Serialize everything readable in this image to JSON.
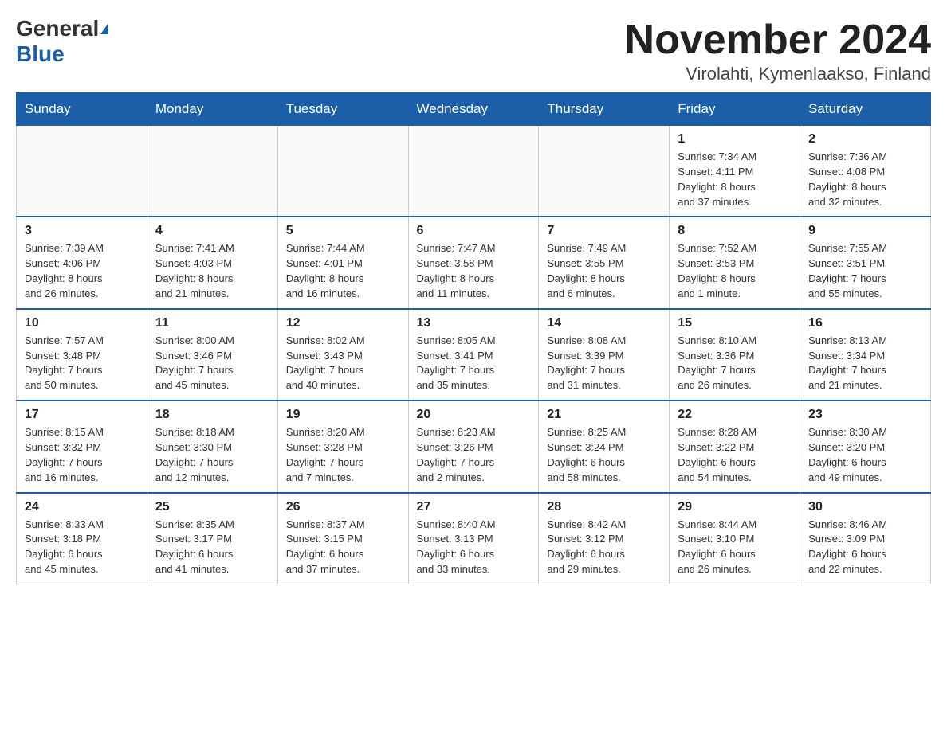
{
  "header": {
    "logo_general": "General",
    "logo_blue": "Blue",
    "month_title": "November 2024",
    "location": "Virolahti, Kymenlaakso, Finland"
  },
  "days_of_week": [
    "Sunday",
    "Monday",
    "Tuesday",
    "Wednesday",
    "Thursday",
    "Friday",
    "Saturday"
  ],
  "weeks": [
    [
      {
        "day": "",
        "info": ""
      },
      {
        "day": "",
        "info": ""
      },
      {
        "day": "",
        "info": ""
      },
      {
        "day": "",
        "info": ""
      },
      {
        "day": "",
        "info": ""
      },
      {
        "day": "1",
        "info": "Sunrise: 7:34 AM\nSunset: 4:11 PM\nDaylight: 8 hours\nand 37 minutes."
      },
      {
        "day": "2",
        "info": "Sunrise: 7:36 AM\nSunset: 4:08 PM\nDaylight: 8 hours\nand 32 minutes."
      }
    ],
    [
      {
        "day": "3",
        "info": "Sunrise: 7:39 AM\nSunset: 4:06 PM\nDaylight: 8 hours\nand 26 minutes."
      },
      {
        "day": "4",
        "info": "Sunrise: 7:41 AM\nSunset: 4:03 PM\nDaylight: 8 hours\nand 21 minutes."
      },
      {
        "day": "5",
        "info": "Sunrise: 7:44 AM\nSunset: 4:01 PM\nDaylight: 8 hours\nand 16 minutes."
      },
      {
        "day": "6",
        "info": "Sunrise: 7:47 AM\nSunset: 3:58 PM\nDaylight: 8 hours\nand 11 minutes."
      },
      {
        "day": "7",
        "info": "Sunrise: 7:49 AM\nSunset: 3:55 PM\nDaylight: 8 hours\nand 6 minutes."
      },
      {
        "day": "8",
        "info": "Sunrise: 7:52 AM\nSunset: 3:53 PM\nDaylight: 8 hours\nand 1 minute."
      },
      {
        "day": "9",
        "info": "Sunrise: 7:55 AM\nSunset: 3:51 PM\nDaylight: 7 hours\nand 55 minutes."
      }
    ],
    [
      {
        "day": "10",
        "info": "Sunrise: 7:57 AM\nSunset: 3:48 PM\nDaylight: 7 hours\nand 50 minutes."
      },
      {
        "day": "11",
        "info": "Sunrise: 8:00 AM\nSunset: 3:46 PM\nDaylight: 7 hours\nand 45 minutes."
      },
      {
        "day": "12",
        "info": "Sunrise: 8:02 AM\nSunset: 3:43 PM\nDaylight: 7 hours\nand 40 minutes."
      },
      {
        "day": "13",
        "info": "Sunrise: 8:05 AM\nSunset: 3:41 PM\nDaylight: 7 hours\nand 35 minutes."
      },
      {
        "day": "14",
        "info": "Sunrise: 8:08 AM\nSunset: 3:39 PM\nDaylight: 7 hours\nand 31 minutes."
      },
      {
        "day": "15",
        "info": "Sunrise: 8:10 AM\nSunset: 3:36 PM\nDaylight: 7 hours\nand 26 minutes."
      },
      {
        "day": "16",
        "info": "Sunrise: 8:13 AM\nSunset: 3:34 PM\nDaylight: 7 hours\nand 21 minutes."
      }
    ],
    [
      {
        "day": "17",
        "info": "Sunrise: 8:15 AM\nSunset: 3:32 PM\nDaylight: 7 hours\nand 16 minutes."
      },
      {
        "day": "18",
        "info": "Sunrise: 8:18 AM\nSunset: 3:30 PM\nDaylight: 7 hours\nand 12 minutes."
      },
      {
        "day": "19",
        "info": "Sunrise: 8:20 AM\nSunset: 3:28 PM\nDaylight: 7 hours\nand 7 minutes."
      },
      {
        "day": "20",
        "info": "Sunrise: 8:23 AM\nSunset: 3:26 PM\nDaylight: 7 hours\nand 2 minutes."
      },
      {
        "day": "21",
        "info": "Sunrise: 8:25 AM\nSunset: 3:24 PM\nDaylight: 6 hours\nand 58 minutes."
      },
      {
        "day": "22",
        "info": "Sunrise: 8:28 AM\nSunset: 3:22 PM\nDaylight: 6 hours\nand 54 minutes."
      },
      {
        "day": "23",
        "info": "Sunrise: 8:30 AM\nSunset: 3:20 PM\nDaylight: 6 hours\nand 49 minutes."
      }
    ],
    [
      {
        "day": "24",
        "info": "Sunrise: 8:33 AM\nSunset: 3:18 PM\nDaylight: 6 hours\nand 45 minutes."
      },
      {
        "day": "25",
        "info": "Sunrise: 8:35 AM\nSunset: 3:17 PM\nDaylight: 6 hours\nand 41 minutes."
      },
      {
        "day": "26",
        "info": "Sunrise: 8:37 AM\nSunset: 3:15 PM\nDaylight: 6 hours\nand 37 minutes."
      },
      {
        "day": "27",
        "info": "Sunrise: 8:40 AM\nSunset: 3:13 PM\nDaylight: 6 hours\nand 33 minutes."
      },
      {
        "day": "28",
        "info": "Sunrise: 8:42 AM\nSunset: 3:12 PM\nDaylight: 6 hours\nand 29 minutes."
      },
      {
        "day": "29",
        "info": "Sunrise: 8:44 AM\nSunset: 3:10 PM\nDaylight: 6 hours\nand 26 minutes."
      },
      {
        "day": "30",
        "info": "Sunrise: 8:46 AM\nSunset: 3:09 PM\nDaylight: 6 hours\nand 22 minutes."
      }
    ]
  ]
}
